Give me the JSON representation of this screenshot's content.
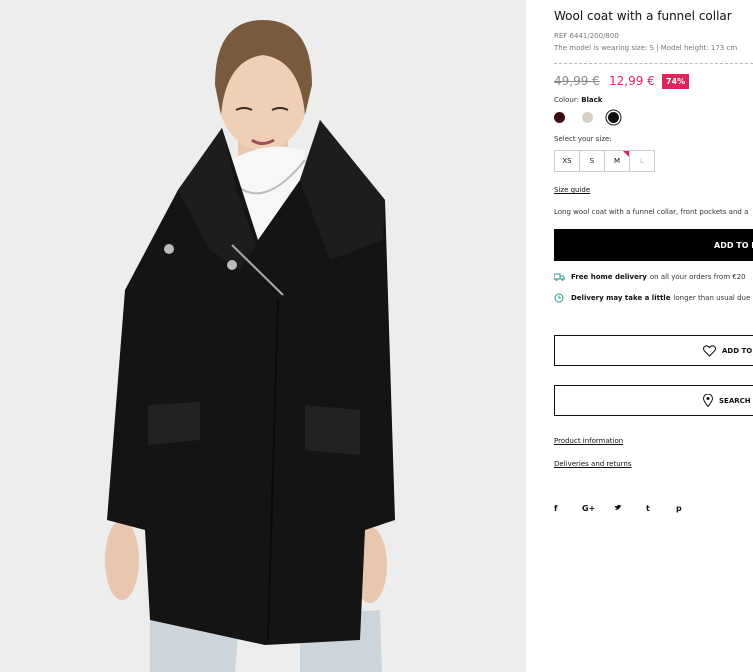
{
  "product": {
    "title": "Wool coat with a funnel collar",
    "ref": "REF 6441/200/800",
    "model_info": "The model is wearing size: S | Model height: 173 cm"
  },
  "price": {
    "old": "49,99 €",
    "new": "12,99 €",
    "discount": "74%"
  },
  "colour": {
    "label": "Colour:",
    "selected": "Black",
    "swatches": [
      "#3a0d12",
      "#d8d0c6",
      "#111111"
    ]
  },
  "size": {
    "label": "Select your size:",
    "options": [
      "XS",
      "S",
      "M",
      "L"
    ],
    "guide_label": "Size guide"
  },
  "description": "Long wool coat with a funnel collar, front pockets and a",
  "add_to_bag_label": "ADD TO B",
  "delivery": {
    "free_bold": "Free home delivery",
    "free_rest": "on all your orders from €20",
    "delay_bold": "Delivery may take a little",
    "delay_rest": "longer than usual due"
  },
  "wishlist_label": "ADD TO",
  "search_store_label": "SEARCH",
  "links": {
    "product_info": "Product information",
    "deliveries": "Deliveries and returns"
  },
  "social": [
    "f",
    "G+",
    "twitter",
    "t",
    "p"
  ],
  "colors": {
    "accent": "#e0245e",
    "button": "#000000"
  }
}
